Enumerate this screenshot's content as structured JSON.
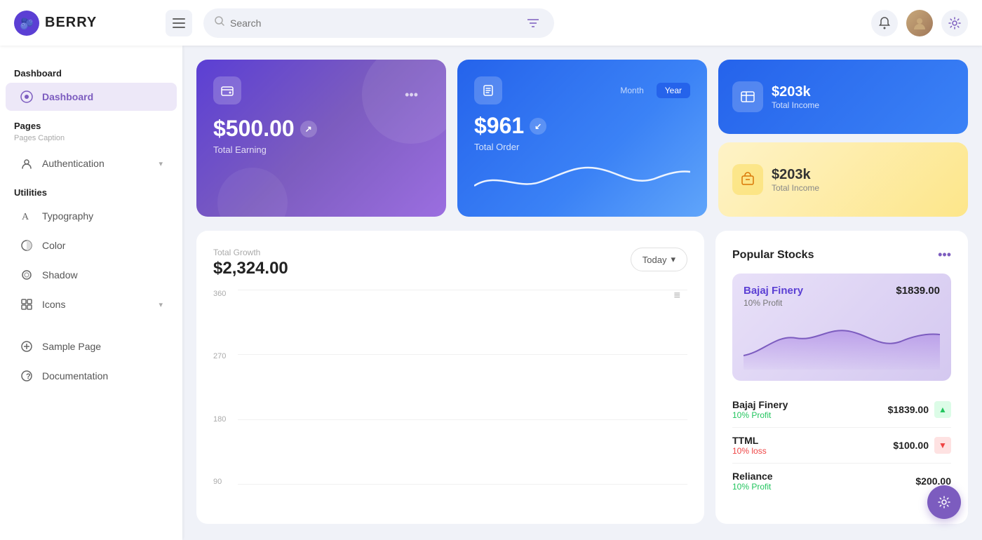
{
  "header": {
    "logo_text": "BERRY",
    "search_placeholder": "Search",
    "hamburger_label": "menu"
  },
  "sidebar": {
    "section_dashboard": "Dashboard",
    "active_item": "Dashboard",
    "dashboard_item": "Dashboard",
    "pages_section": "Pages",
    "pages_caption": "Pages Caption",
    "authentication_item": "Authentication",
    "utilities_section": "Utilities",
    "typography_item": "Typography",
    "color_item": "Color",
    "shadow_item": "Shadow",
    "icons_item": "Icons",
    "sample_page_item": "Sample Page",
    "documentation_item": "Documentation"
  },
  "cards": {
    "earning_amount": "$500.00",
    "earning_label": "Total Earning",
    "order_amount": "$961",
    "order_label": "Total Order",
    "month_tab": "Month",
    "year_tab": "Year",
    "income1_amount": "$203k",
    "income1_label": "Total Income",
    "income2_amount": "$203k",
    "income2_label": "Total Income"
  },
  "growth_chart": {
    "title": "Total Growth",
    "amount": "$2,324.00",
    "today_btn": "Today",
    "y_labels": [
      "360",
      "270",
      "180",
      "90"
    ],
    "more_icon": "≡"
  },
  "stocks": {
    "title": "Popular Stocks",
    "more_icon": "•••",
    "featured_name": "Bajaj Finery",
    "featured_price": "$1839.00",
    "featured_profit": "10% Profit",
    "items": [
      {
        "name": "Bajaj Finery",
        "profit": "10% Profit",
        "profit_type": "up",
        "price": "$1839.00"
      },
      {
        "name": "TTML",
        "profit": "10% loss",
        "profit_type": "down",
        "price": "$100.00"
      },
      {
        "name": "Reliance",
        "profit": "10% Profit",
        "profit_type": "up",
        "price": "$200.00"
      }
    ]
  },
  "fab": {
    "icon": "⚙"
  }
}
